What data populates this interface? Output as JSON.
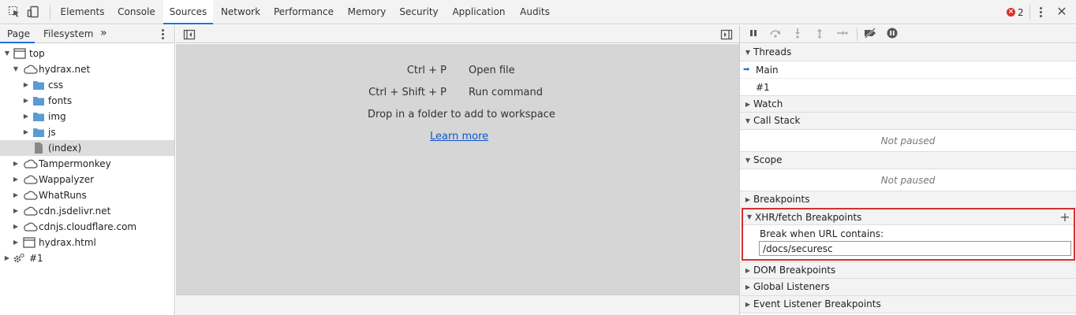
{
  "toolbar": {
    "tabs": [
      "Elements",
      "Console",
      "Sources",
      "Network",
      "Performance",
      "Memory",
      "Security",
      "Application",
      "Audits"
    ],
    "active_tab": "Sources",
    "error_count": "2",
    "accent_color": "#1a73e8",
    "error_color": "#d93025"
  },
  "navigator": {
    "tabs": [
      "Page",
      "Filesystem"
    ],
    "more": "»",
    "tree": [
      {
        "label": "top",
        "icon": "frame-icon",
        "expanded": true
      },
      {
        "label": "hydrax.net",
        "icon": "cloud-icon",
        "expanded": true
      },
      {
        "label": "css",
        "icon": "folder-icon",
        "expanded": false
      },
      {
        "label": "fonts",
        "icon": "folder-icon",
        "expanded": false
      },
      {
        "label": "img",
        "icon": "folder-icon",
        "expanded": false
      },
      {
        "label": "js",
        "icon": "folder-icon",
        "expanded": false
      },
      {
        "label": "(index)",
        "icon": "file-icon",
        "selected": true
      },
      {
        "label": "Tampermonkey",
        "icon": "cloud-icon",
        "expanded": false
      },
      {
        "label": "Wappalyzer",
        "icon": "cloud-icon",
        "expanded": false
      },
      {
        "label": "WhatRuns",
        "icon": "cloud-icon",
        "expanded": false
      },
      {
        "label": "cdn.jsdelivr.net",
        "icon": "cloud-icon",
        "expanded": false
      },
      {
        "label": "cdnjs.cloudflare.com",
        "icon": "cloud-icon",
        "expanded": false
      },
      {
        "label": "hydrax.html",
        "icon": "frame-icon",
        "expanded": false
      },
      {
        "label": "#1",
        "icon": "gear-icon",
        "expanded": false
      }
    ]
  },
  "editor": {
    "shortcuts": [
      {
        "keys": "Ctrl + P",
        "action": "Open file"
      },
      {
        "keys": "Ctrl + Shift + P",
        "action": "Run command"
      }
    ],
    "drop_text": "Drop in a folder to add to workspace",
    "learn_more": "Learn more"
  },
  "debugger": {
    "sections": {
      "threads": "Threads",
      "threads_main": "Main",
      "threads_other": "#1",
      "watch": "Watch",
      "call_stack": "Call Stack",
      "call_stack_body": "Not paused",
      "scope": "Scope",
      "scope_body": "Not paused",
      "breakpoints": "Breakpoints",
      "xhr": "XHR/fetch Breakpoints",
      "xhr_label": "Break when URL contains:",
      "xhr_value": "/docs/securesc",
      "dom": "DOM Breakpoints",
      "global": "Global Listeners",
      "event": "Event Listener Breakpoints"
    },
    "highlight_color": "#d32f2f"
  }
}
